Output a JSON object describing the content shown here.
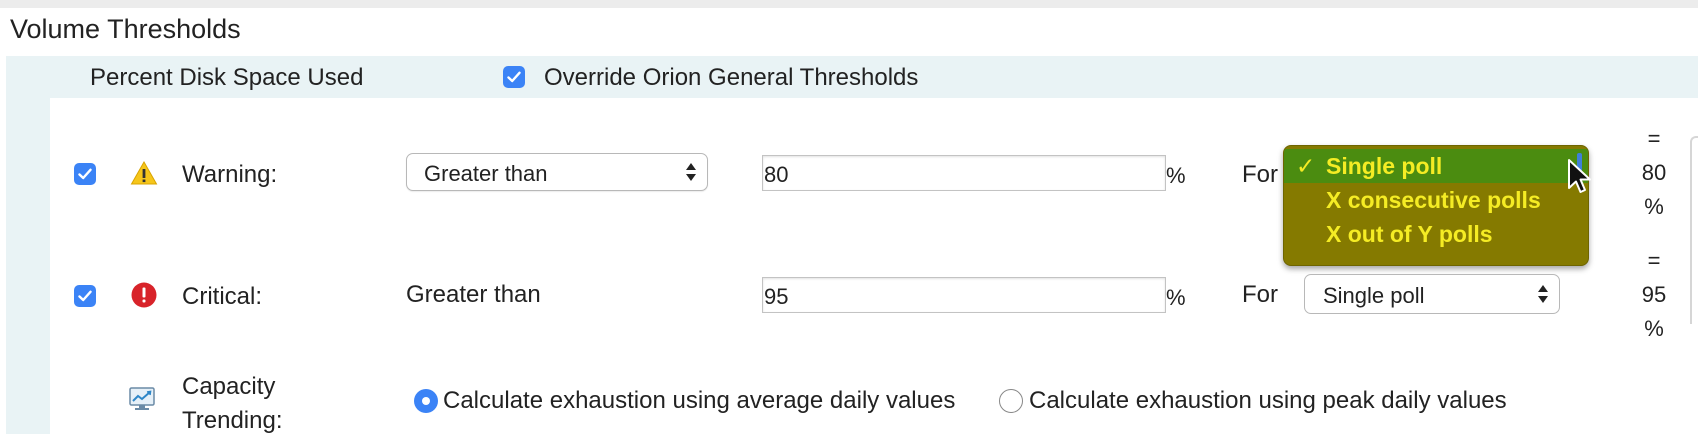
{
  "section_title": "Volume Thresholds",
  "header": {
    "metric_label": "Percent Disk Space Used",
    "override_label": "Override Orion General Thresholds",
    "override_checked": true
  },
  "warning": {
    "checked": true,
    "label": "Warning:",
    "operator": "Greater than",
    "value": "80",
    "unit": "%",
    "for_label": "For",
    "dropdown_options": [
      "Single poll",
      "X consecutive polls",
      "X out of Y polls"
    ],
    "selected_option": "Single poll",
    "side_equals": "=",
    "side_value": "80",
    "side_unit": "%"
  },
  "critical": {
    "checked": true,
    "label": "Critical:",
    "operator": "Greater than",
    "value": "95",
    "unit": "%",
    "for_label": "For",
    "poll_select": "Single poll",
    "side_equals": "=",
    "side_value": "95",
    "side_unit": "%"
  },
  "capacity": {
    "label_line1": "Capacity",
    "label_line2": "Trending:",
    "option_average": "Calculate exhaustion using average daily values",
    "option_peak": "Calculate exhaustion using peak daily values",
    "selected": "average"
  },
  "colors": {
    "accent": "#3b83f6",
    "dropdown_bg": "#857a00",
    "dropdown_selected_bg": "#4b8c10",
    "dropdown_text": "#f5ec24",
    "band_bg": "#e9f3f5"
  },
  "icons": {
    "warning": "warning-triangle-icon",
    "critical": "critical-exclamation-icon",
    "capacity": "trend-chart-icon"
  }
}
